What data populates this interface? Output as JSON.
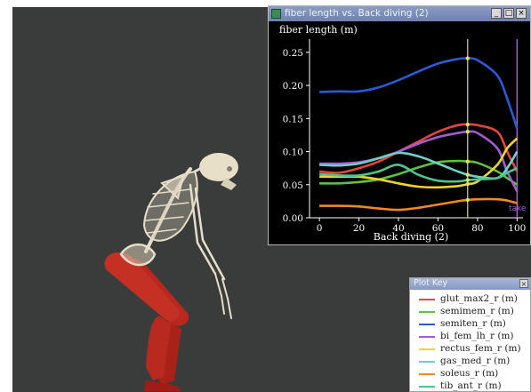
{
  "plot_window": {
    "title": "fiber length vs. Back diving (2)",
    "buttons": {
      "minimize": "_",
      "maximize": "□",
      "close": "×"
    },
    "marker_label": "take"
  },
  "plot_key": {
    "title": "Plot Key",
    "close": "×",
    "items": [
      {
        "label": "glut_max2_r (m)",
        "color": "#e8463a"
      },
      {
        "label": "semimem_r (m)",
        "color": "#5ec23c"
      },
      {
        "label": "semiten_r (m)",
        "color": "#2a5ad6"
      },
      {
        "label": "bi_fem_lh_r (m)",
        "color": "#a35cd1"
      },
      {
        "label": "rectus_fem_r (m)",
        "color": "#f0d528"
      },
      {
        "label": "gas_med_r (m)",
        "color": "#6ed1c9"
      },
      {
        "label": "soleus_r (m)",
        "color": "#f08a1c"
      },
      {
        "label": "tib_ant_r (m)",
        "color": "#4fc48f"
      }
    ]
  },
  "colors": {
    "viewport_background": "#3a3c3c",
    "plot_background": "#000000",
    "cursor_line": "#d6e06a",
    "end_marker": "#a35cd1"
  },
  "chart_data": {
    "type": "line",
    "title": "",
    "ylabel": "fiber length (m)",
    "xlabel": "Back diving (2)",
    "xlim": [
      -5,
      103
    ],
    "ylim": [
      0,
      0.27
    ],
    "x_ticks": [
      0,
      20,
      40,
      60,
      80,
      100
    ],
    "y_ticks": [
      0.0,
      0.05,
      0.1,
      0.15,
      0.2,
      0.25
    ],
    "y_tick_labels": [
      "0.00",
      "0.05",
      "0.10",
      "0.15",
      "0.20",
      "0.25"
    ],
    "grid": false,
    "cursor_x": 75,
    "end_marker_x": 100,
    "x": [
      0,
      10,
      20,
      30,
      40,
      50,
      60,
      70,
      75,
      80,
      90,
      95,
      100
    ],
    "series": [
      {
        "name": "glut_max2_r (m)",
        "color": "#e8463a",
        "values": [
          0.07,
          0.068,
          0.075,
          0.085,
          0.1,
          0.115,
          0.13,
          0.14,
          0.141,
          0.14,
          0.13,
          0.1,
          0.07
        ]
      },
      {
        "name": "semimem_r (m)",
        "color": "#5ec23c",
        "values": [
          0.052,
          0.052,
          0.054,
          0.058,
          0.066,
          0.076,
          0.084,
          0.086,
          0.085,
          0.083,
          0.07,
          0.06,
          0.05
        ]
      },
      {
        "name": "semiten_r (m)",
        "color": "#2a5ad6",
        "values": [
          0.19,
          0.191,
          0.191,
          0.197,
          0.208,
          0.221,
          0.233,
          0.24,
          0.241,
          0.238,
          0.215,
          0.18,
          0.135
        ]
      },
      {
        "name": "bi_fem_lh_r (m)",
        "color": "#a35cd1",
        "values": [
          0.082,
          0.082,
          0.084,
          0.09,
          0.1,
          0.112,
          0.122,
          0.128,
          0.13,
          0.128,
          0.105,
          0.07,
          0.04
        ]
      },
      {
        "name": "rectus_fem_r (m)",
        "color": "#f0d528",
        "values": [
          0.062,
          0.062,
          0.062,
          0.058,
          0.052,
          0.047,
          0.046,
          0.048,
          0.051,
          0.055,
          0.08,
          0.105,
          0.12
        ]
      },
      {
        "name": "gas_med_r (m)",
        "color": "#6ed1c9",
        "values": [
          0.08,
          0.079,
          0.082,
          0.09,
          0.098,
          0.093,
          0.082,
          0.07,
          0.065,
          0.062,
          0.06,
          0.075,
          0.1
        ]
      },
      {
        "name": "soleus_r (m)",
        "color": "#f08a1c",
        "values": [
          0.018,
          0.018,
          0.017,
          0.014,
          0.012,
          0.015,
          0.02,
          0.025,
          0.027,
          0.028,
          0.028,
          0.026,
          0.022
        ]
      },
      {
        "name": "tib_ant_r (m)",
        "color": "#4fc48f",
        "values": [
          0.066,
          0.064,
          0.064,
          0.07,
          0.08,
          0.065,
          0.056,
          0.055,
          0.057,
          0.058,
          0.06,
          0.068,
          0.075
        ]
      }
    ]
  }
}
